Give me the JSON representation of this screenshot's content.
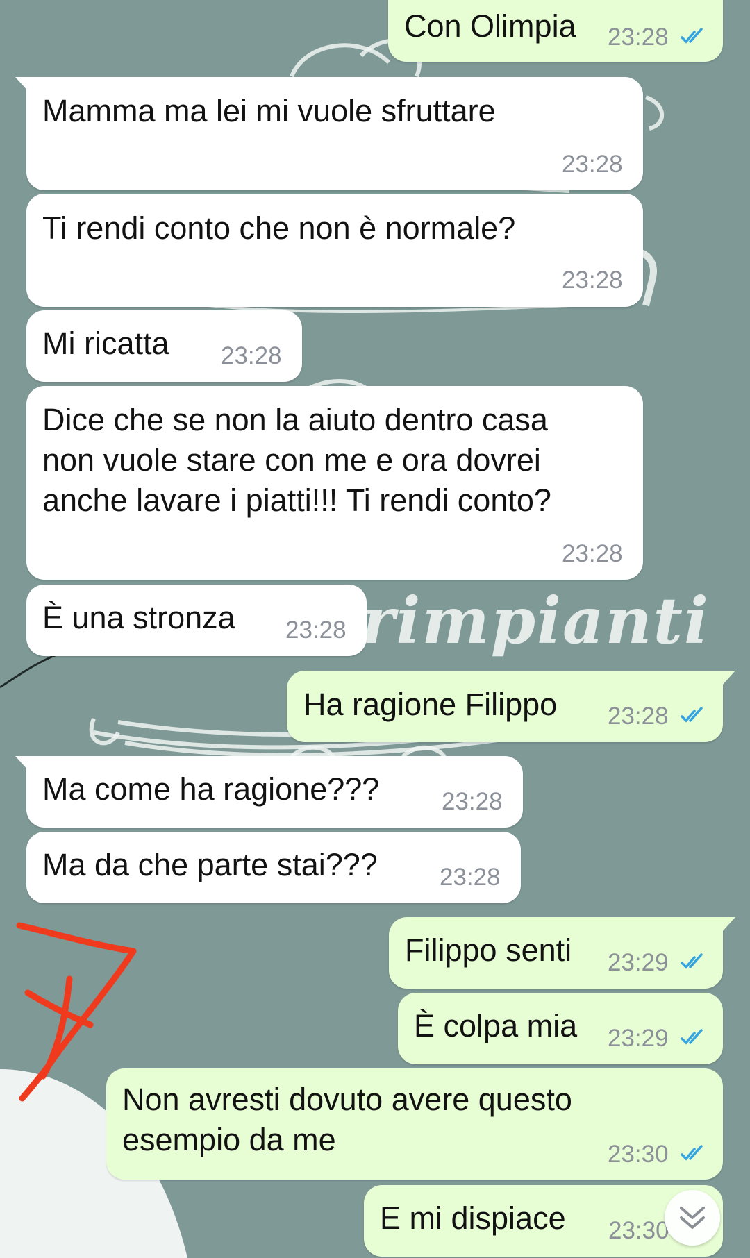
{
  "wallpaper": {
    "word": "rimpianti"
  },
  "messages": [
    {
      "id": "m1",
      "dir": "out",
      "text": "Con Olimpia",
      "time": "23:28",
      "read": true
    },
    {
      "id": "m2",
      "dir": "in",
      "text": "Mamma ma lei mi vuole sfruttare",
      "time": "23:28"
    },
    {
      "id": "m3",
      "dir": "in",
      "text": "Ti rendi conto che non è normale?",
      "time": "23:28"
    },
    {
      "id": "m4",
      "dir": "in",
      "text": "Mi ricatta",
      "time": "23:28"
    },
    {
      "id": "m5",
      "dir": "in",
      "text": "Dice che se non la aiuto dentro casa\nnon vuole stare con me e ora dovrei\nanche lavare i piatti!!! Ti rendi conto?",
      "time": "23:28"
    },
    {
      "id": "m6",
      "dir": "in",
      "text": "È una stronza",
      "time": "23:28"
    },
    {
      "id": "m7",
      "dir": "out",
      "text": "Ha ragione Filippo",
      "time": "23:28",
      "read": true
    },
    {
      "id": "m8",
      "dir": "in",
      "text": "Ma come ha ragione???",
      "time": "23:28"
    },
    {
      "id": "m9",
      "dir": "in",
      "text": "Ma da che parte stai???",
      "time": "23:28"
    },
    {
      "id": "m10",
      "dir": "out",
      "text": "Filippo senti",
      "time": "23:29",
      "read": true
    },
    {
      "id": "m11",
      "dir": "out",
      "text": "È colpa mia",
      "time": "23:29",
      "read": true
    },
    {
      "id": "m12",
      "dir": "out",
      "text": "Non avresti dovuto avere questo\nesempio da me",
      "time": "23:30",
      "read": true
    },
    {
      "id": "m13",
      "dir": "out",
      "text": "E mi dispiace",
      "time": "23:30",
      "read": false
    }
  ],
  "colors": {
    "background": "#7e9996",
    "incoming": "#ffffff",
    "outgoing": "#e7fdd3",
    "read_ticks": "#34a3e0",
    "annotation": "#f03a1e"
  },
  "icons": {
    "scroll_down": "chevron-double-down-icon",
    "read_receipt": "double-check-icon"
  }
}
